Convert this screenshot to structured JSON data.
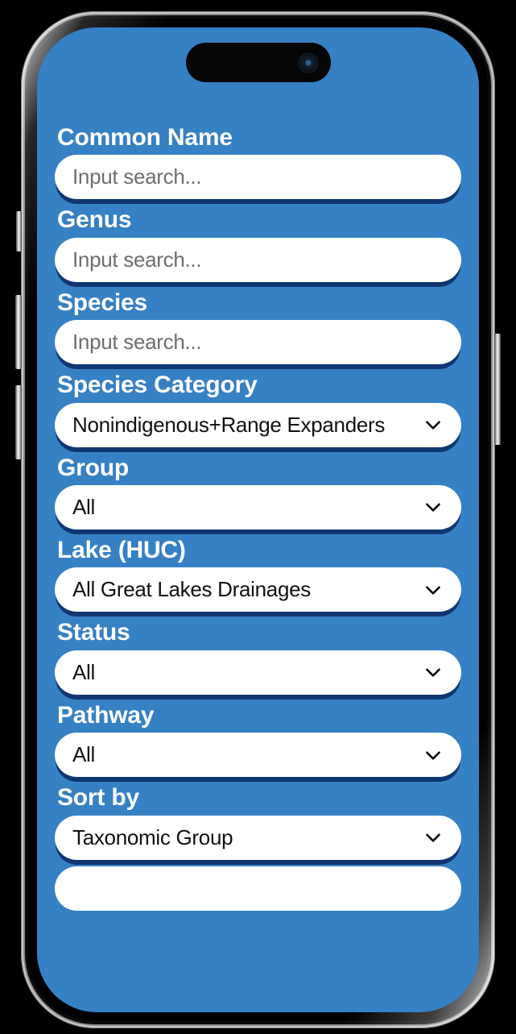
{
  "device": {
    "name": "iphone-mockup",
    "dynamic_island": "dynamic-island",
    "camera_icon": "camera-lens-icon",
    "buttons": [
      "silence-switch",
      "volume-up-button",
      "volume-down-button",
      "power-button"
    ]
  },
  "theme": {
    "screen_background": "#3680C4",
    "control_background": "#FFFFFF",
    "label_color": "#FFFFFF",
    "value_color": "#111111",
    "placeholder_color": "#6E6E6E",
    "shadow_color": "#0D3069"
  },
  "form": {
    "fields": [
      {
        "label": "Common Name",
        "type": "text",
        "value": "",
        "placeholder": "Input search...",
        "name": "common-name"
      },
      {
        "label": "Genus",
        "type": "text",
        "value": "",
        "placeholder": "Input search...",
        "name": "genus"
      },
      {
        "label": "Species",
        "type": "text",
        "value": "",
        "placeholder": "Input search...",
        "name": "species"
      },
      {
        "label": "Species Category",
        "type": "select",
        "value": "Nonindigenous+Range Expanders",
        "icon": "chevron-down-icon",
        "name": "species-category"
      },
      {
        "label": "Group",
        "type": "select",
        "value": "All",
        "icon": "chevron-down-icon",
        "name": "group"
      },
      {
        "label": "Lake (HUC)",
        "type": "select",
        "value": "All Great Lakes Drainages",
        "icon": "chevron-down-icon",
        "name": "lake-huc"
      },
      {
        "label": "Status",
        "type": "select",
        "value": "All",
        "icon": "chevron-down-icon",
        "name": "status"
      },
      {
        "label": "Pathway",
        "type": "select",
        "value": "All",
        "icon": "chevron-down-icon",
        "name": "pathway"
      },
      {
        "label": "Sort by",
        "type": "select",
        "value": "Taxonomic Group",
        "icon": "chevron-down-icon",
        "name": "sort-by"
      }
    ]
  }
}
